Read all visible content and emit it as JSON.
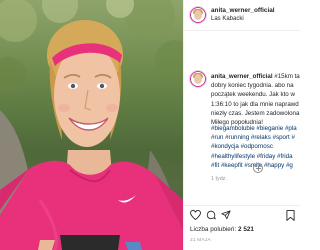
{
  "post": {
    "username": "anita_werner_official",
    "location": "Las Kabacki",
    "caption_lines": [
      "#15km ta",
      "dobry koniec tygodnia. abo na",
      "początek weekendu. Jak kto w",
      "1:36:10 to jak dla mnie naprawd",
      "niezły czas. Jestem zadowolona",
      "Miłego popołudnia!"
    ],
    "hashtag_lines": [
      "#biegambolubie #bieganie #pla",
      "#run #running #relaks #sport #",
      "#kondycja #odpornosc",
      "#healthylifestyle #friday #frida",
      "#fit #keepfit #smile #happy #g"
    ],
    "time_ago": "1 tydz.",
    "likes_label": "Liczba polubień",
    "likes_count": "2 521",
    "date": "21 MAJA"
  },
  "icons": [
    "avatar",
    "add-comment-icon",
    "heart-icon",
    "comment-icon",
    "share-icon",
    "bookmark-icon"
  ],
  "colors": {
    "accent_pink": "#e8317a",
    "hashtag": "#003569",
    "muted": "#999999"
  }
}
